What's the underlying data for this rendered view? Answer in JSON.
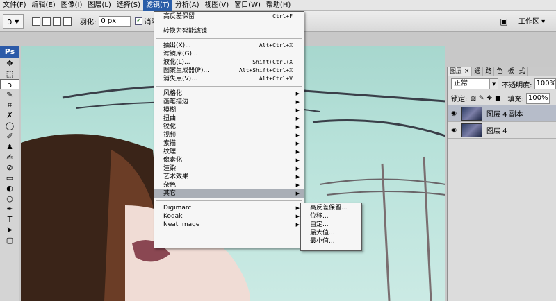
{
  "menubar": {
    "items": [
      "文件(F)",
      "编辑(E)",
      "图像(I)",
      "图层(L)",
      "选择(S)",
      "滤镜(T)",
      "分析(A)",
      "视图(V)",
      "窗口(W)",
      "帮助(H)"
    ],
    "active": "滤镜(T)"
  },
  "options": {
    "feather_label": "羽化:",
    "feather_value": "0 px",
    "antialias_label": "消除锯齿",
    "antialias_checked": "✓",
    "workspace_label": "工作区 ▾"
  },
  "toolbox": {
    "logo": "Ps",
    "tools": [
      "✥",
      "⬚",
      "ↄ",
      "✎",
      "⌗",
      "✗",
      "◯",
      "✐",
      "♟",
      "✍",
      "⊘",
      "▭",
      "◐",
      "○",
      "✒",
      "T",
      "➤",
      "▢"
    ]
  },
  "filter_menu": {
    "last_filter": {
      "label": "高反差保留",
      "shortcut": "Ctrl+F"
    },
    "smart": "转换为智能滤镜",
    "special": [
      {
        "label": "抽出(X)...",
        "shortcut": "Alt+Ctrl+X"
      },
      {
        "label": "滤镜库(G)...",
        "shortcut": ""
      },
      {
        "label": "液化(L)...",
        "shortcut": "Shift+Ctrl+X"
      },
      {
        "label": "图案生成器(P)...",
        "shortcut": "Alt+Shift+Ctrl+X"
      },
      {
        "label": "消失点(V)...",
        "shortcut": "Alt+Ctrl+V"
      }
    ],
    "categories": [
      "风格化",
      "画笔描边",
      "模糊",
      "扭曲",
      "锐化",
      "视频",
      "素描",
      "纹理",
      "像素化",
      "渲染",
      "艺术效果",
      "杂色",
      "其它"
    ],
    "plugins": [
      "Digimarc",
      "Kodak",
      "Neat Image"
    ],
    "highlighted": "其它"
  },
  "submenu": {
    "items": [
      "高反差保留...",
      "位移...",
      "自定...",
      "最大值...",
      "最小值..."
    ]
  },
  "layers_panel": {
    "tabs": [
      "图层 ×",
      "通",
      "路",
      "色",
      "板",
      "式"
    ],
    "blend_mode": "正常",
    "opacity_label": "不透明度:",
    "opacity_value": "100%",
    "lock_label": "锁定:",
    "fill_label": "填充:",
    "fill_value": "100%",
    "layers": [
      {
        "name": "图层 4 副本",
        "selected": true
      },
      {
        "name": "图层 4",
        "selected": false
      }
    ]
  }
}
